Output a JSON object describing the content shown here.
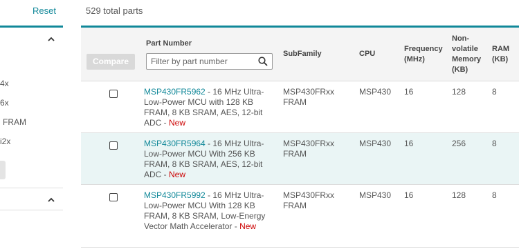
{
  "sidebar": {
    "reset_label": "Reset",
    "filter_items": [
      "4x",
      "6x",
      "FRAM",
      "i2x"
    ]
  },
  "results": {
    "total_text": "529 total parts",
    "compare_label": "Compare",
    "filter_placeholder": "Filter by part number",
    "headers": {
      "part_number": "Part Number",
      "subfamily": "SubFamily",
      "cpu": "CPU",
      "frequency": "Frequency (MHz)",
      "nvm": "Non-volatile Memory (KB)",
      "ram": "RAM (KB)"
    },
    "rows": [
      {
        "part": "MSP430FR5962",
        "desc": " - 16 MHz Ultra-Low-Power MCU with 128 KB FRAM, 8 KB SRAM, AES, 12-bit ADC - ",
        "new": "New",
        "subfamily": "MSP430FRxx FRAM",
        "cpu": "MSP430",
        "freq": "16",
        "nvm": "128",
        "ram": "8"
      },
      {
        "part": "MSP430FR5964",
        "desc": " - 16 MHz Ultra-Low-Power MCU With 256 KB FRAM, 8 KB SRAM, AES, 12-bit ADC - ",
        "new": "New",
        "subfamily": "MSP430FRxx FRAM",
        "cpu": "MSP430",
        "freq": "16",
        "nvm": "256",
        "ram": "8"
      },
      {
        "part": "MSP430FR5992",
        "desc": " - 16 MHz Ultra-Low-Power MCU With 128 KB FRAM, 8 KB SRAM, Low-Energy Vector Math Accelerator - ",
        "new": "New",
        "subfamily": "MSP430FRxx FRAM",
        "cpu": "MSP430",
        "freq": "16",
        "nvm": "128",
        "ram": "8"
      }
    ]
  },
  "colors": {
    "accent": "#118899",
    "new_badge": "#cc0000",
    "row_highlight": "#eaf5f5"
  },
  "icons": [
    "chevron-up-icon",
    "search-icon"
  ]
}
